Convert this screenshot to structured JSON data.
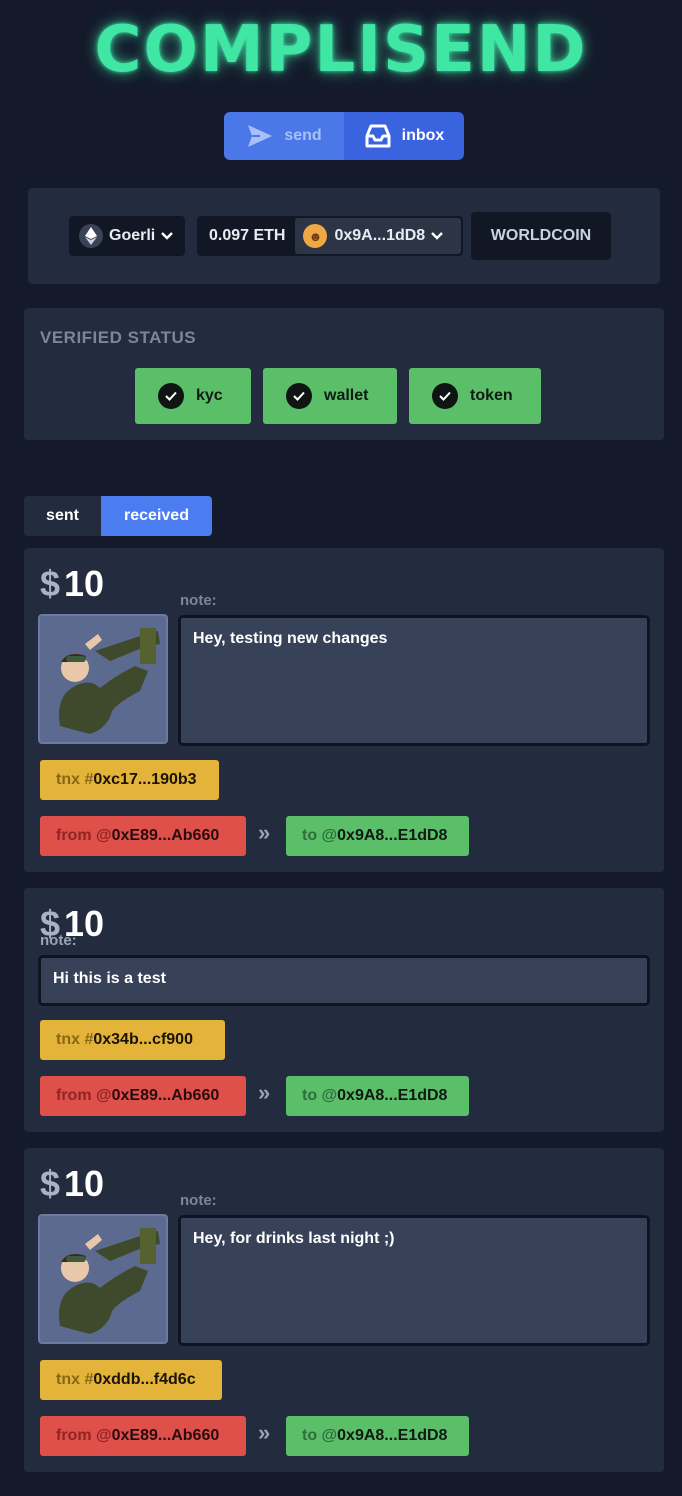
{
  "app": {
    "logo": "COMPLISEND"
  },
  "modes": {
    "send_label": "send",
    "inbox_label": "inbox",
    "active": "inbox"
  },
  "wallet": {
    "network": "Goerli",
    "balance": "0.097 ETH",
    "address": "0x9A...1dD8",
    "worldcoin_label": "WORLDCOIN"
  },
  "verified": {
    "title": "VERIFIED STATUS",
    "badges": [
      {
        "label": "kyc"
      },
      {
        "label": "wallet"
      },
      {
        "label": "token"
      }
    ]
  },
  "tabs": {
    "sent_label": "sent",
    "received_label": "received",
    "active": "received"
  },
  "labels": {
    "currency": "$",
    "note": "note:",
    "tnx_prefix": "tnx #",
    "from_prefix": "from @",
    "to_prefix": "to @",
    "arrow": "»"
  },
  "transactions": [
    {
      "amount": "10",
      "note": "Hey, testing new changes",
      "tnx": "0xc17...190b3",
      "from": "0xE89...Ab660",
      "to": "0x9A8...E1dD8",
      "has_image": true
    },
    {
      "amount": "10",
      "note": "Hi this is a test",
      "tnx": "0x34b...cf900",
      "from": "0xE89...Ab660",
      "to": "0x9A8...E1dD8",
      "has_image": false
    },
    {
      "amount": "10",
      "note": "Hey, for drinks last night ;)",
      "tnx": "0xddb...f4d6c",
      "from": "0xE89...Ab660",
      "to": "0x9A8...E1dD8",
      "has_image": true
    }
  ],
  "colors": {
    "background": "#141a2b",
    "panel": "#232b3e",
    "logo_green": "#3fe6a4",
    "accent_blue": "#4b7cf0",
    "success_green": "#5bbf6a",
    "warning_yellow": "#e3b33a",
    "danger_red": "#e0504b"
  }
}
